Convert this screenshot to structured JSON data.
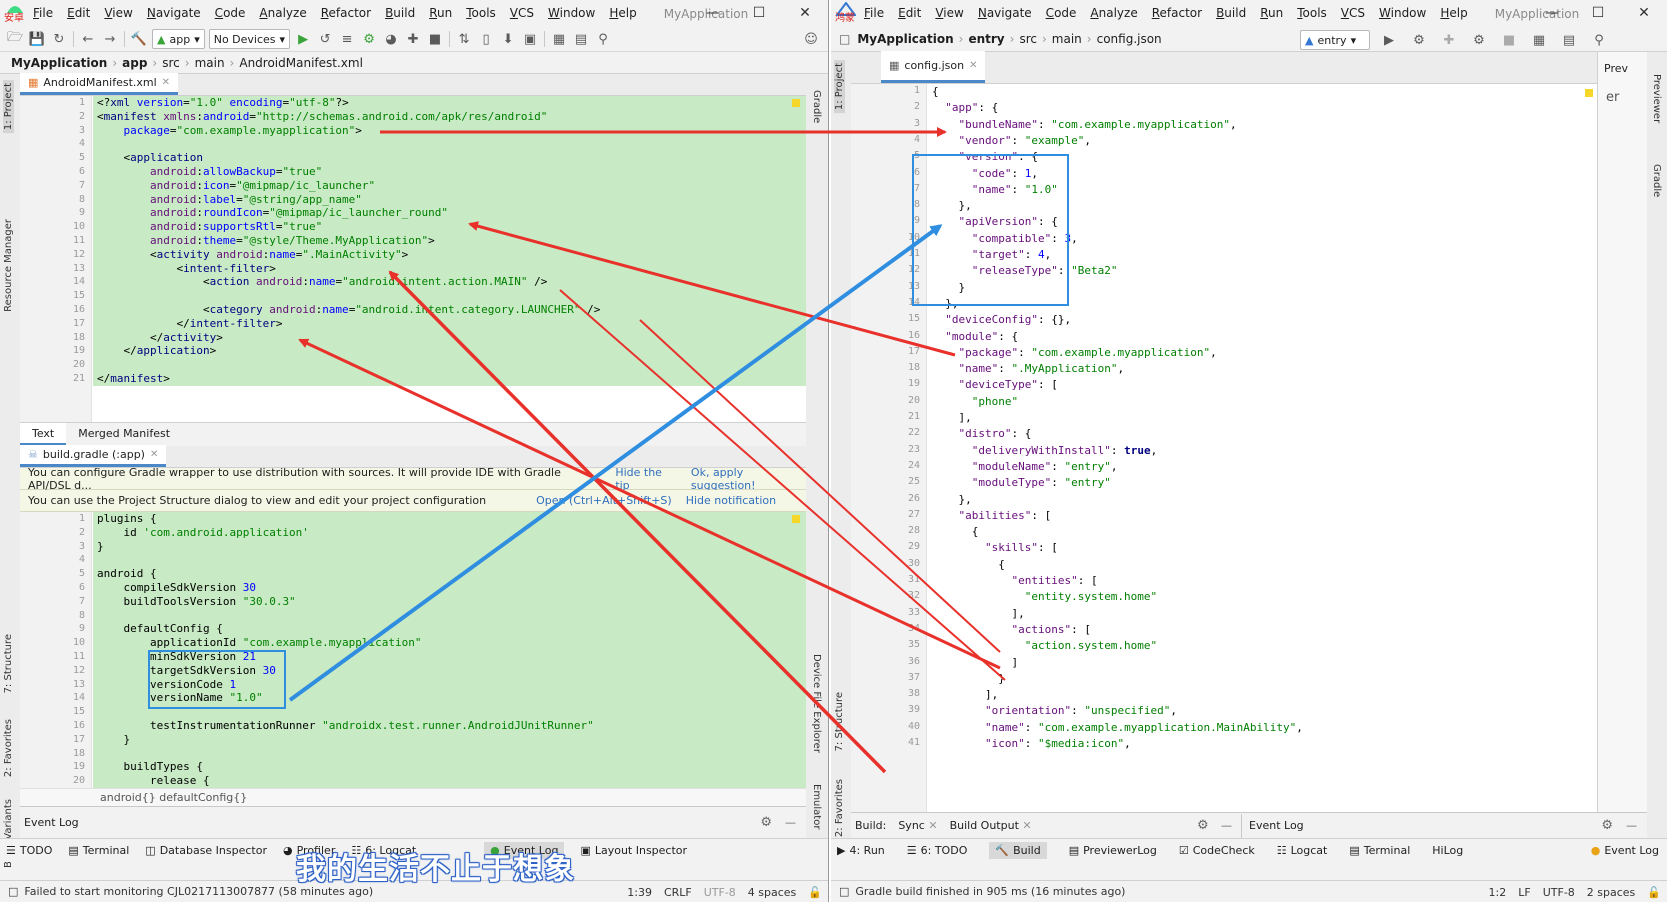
{
  "left": {
    "brand_tag": "安卓",
    "menu": [
      "File",
      "Edit",
      "View",
      "Navigate",
      "Code",
      "Analyze",
      "Refactor",
      "Build",
      "Run",
      "Tools",
      "VCS",
      "Window",
      "Help"
    ],
    "title": "MyApplication",
    "toolbar": {
      "module": "app",
      "device": "No Devices"
    },
    "breadcrumb": [
      "MyApplication",
      "app",
      "src",
      "main",
      "AndroidManifest.xml"
    ],
    "side_tabs": [
      "1: Project",
      "Resource Manager",
      "7: Structure",
      "2: Favorites",
      "Build Variants"
    ],
    "right_side_tabs": [
      "Gradle",
      "Device File Explorer",
      "Emulator"
    ],
    "manifest_tab": "AndroidManifest.xml",
    "manifest_lines": [
      "<?xml version=\"1.0\" encoding=\"utf-8\"?>",
      "<manifest xmlns:android=\"http://schemas.android.com/apk/res/android\"",
      "    package=\"com.example.myapplication\">",
      "",
      "    <application",
      "        android:allowBackup=\"true\"",
      "        android:icon=\"@mipmap/ic_launcher\"",
      "        android:label=\"@string/app_name\"",
      "        android:roundIcon=\"@mipmap/ic_launcher_round\"",
      "        android:supportsRtl=\"true\"",
      "        android:theme=\"@style/Theme.MyApplication\">",
      "        <activity android:name=\".MainActivity\">",
      "            <intent-filter>",
      "                <action android:name=\"android.intent.action.MAIN\" />",
      "",
      "                <category android:name=\"android.intent.category.LAUNCHER\" />",
      "            </intent-filter>",
      "        </activity>",
      "    </application>",
      "",
      "</manifest>"
    ],
    "manifest_subtabs": [
      "Text",
      "Merged Manifest"
    ],
    "gradle_tab": "build.gradle (:app)",
    "notice1": {
      "text": "You can configure Gradle wrapper to use distribution with sources. It will provide IDE with Gradle API/DSL d...",
      "link1": "Hide the tip",
      "link2": "Ok, apply suggestion!"
    },
    "notice2": {
      "text": "You can use the Project Structure dialog to view and edit your project configuration",
      "link1": "Open (Ctrl+Alt+Shift+S)",
      "link2": "Hide notification"
    },
    "gradle_lines": [
      "plugins {",
      "    id 'com.android.application'",
      "}",
      "",
      "android {",
      "    compileSdkVersion 30",
      "    buildToolsVersion \"30.0.3\"",
      "",
      "    defaultConfig {",
      "        applicationId \"com.example.myapplication\"",
      "        minSdkVersion 21",
      "        targetSdkVersion 30",
      "        versionCode 1",
      "        versionName \"1.0\"",
      "",
      "        testInstrumentationRunner \"androidx.test.runner.AndroidJUnitRunner\"",
      "    }",
      "",
      "    buildTypes {",
      "        release {"
    ],
    "gradle_breadcrumb": "android{}   defaultConfig{}",
    "event_log_title": "Event Log",
    "bottom_tabs": [
      "TODO",
      "Terminal",
      "Database Inspector",
      "Profiler",
      "6: Logcat",
      "Event Log",
      "Layout Inspector"
    ],
    "status": "Failed to start monitoring CJL0217113007877 (58 minutes ago)",
    "status_right": [
      "1:39",
      "CRLF",
      "UTF-8",
      "4 spaces"
    ]
  },
  "right": {
    "brand_tag": "鸿蒙",
    "menu": [
      "File",
      "Edit",
      "View",
      "Navigate",
      "Code",
      "Analyze",
      "Refactor",
      "Build",
      "Run",
      "Tools",
      "VCS",
      "Window",
      "Help"
    ],
    "title": "MyApplication",
    "toolbar": {
      "module": "entry"
    },
    "breadcrumb": [
      "MyApplication",
      "entry",
      "src",
      "main",
      "config.json"
    ],
    "side_tabs": [
      "1: Project",
      "7: Structure",
      "2: Favorites"
    ],
    "right_side_tabs": [
      "Previewer",
      "Gradle"
    ],
    "preview_label": "Prev",
    "preview_glyph": "er",
    "config_tab": "config.json",
    "config_lines": [
      "{",
      "  \"app\": {",
      "    \"bundleName\": \"com.example.myapplication\",",
      "    \"vendor\": \"example\",",
      "    \"version\": {",
      "      \"code\": 1,",
      "      \"name\": \"1.0\"",
      "    },",
      "    \"apiVersion\": {",
      "      \"compatible\": 3,",
      "      \"target\": 4,",
      "      \"releaseType\": \"Beta2\"",
      "    }",
      "  },",
      "  \"deviceConfig\": {},",
      "  \"module\": {",
      "    \"package\": \"com.example.myapplication\",",
      "    \"name\": \".MyApplication\",",
      "    \"deviceType\": [",
      "      \"phone\"",
      "    ],",
      "    \"distro\": {",
      "      \"deliveryWithInstall\": true,",
      "      \"moduleName\": \"entry\",",
      "      \"moduleType\": \"entry\"",
      "    },",
      "    \"abilities\": [",
      "      {",
      "        \"skills\": [",
      "          {",
      "            \"entities\": [",
      "              \"entity.system.home\"",
      "            ],",
      "            \"actions\": [",
      "              \"action.system.home\"",
      "            ]",
      "          }",
      "        ],",
      "        \"orientation\": \"unspecified\",",
      "        \"name\": \"com.example.myapplication.MainAbility\",",
      "        \"icon\": \"$media:icon\","
    ],
    "build_panel": {
      "label": "Build:",
      "tab1": "Sync",
      "tab2": "Build Output"
    },
    "event_log_title": "Event Log",
    "bottom_tabs": [
      "4: Run",
      "6: TODO",
      "Build",
      "PreviewerLog",
      "CodeCheck",
      "Logcat",
      "Terminal",
      "HiLog"
    ],
    "event_log_tab": "Event Log",
    "status": "Gradle build finished in 905 ms (16 minutes ago)",
    "status_right": [
      "1:2",
      "LF",
      "UTF-8",
      "2 spaces"
    ]
  },
  "watermark": "我的生活不止于想象",
  "colors": {
    "arrow_red": "#e8312b",
    "arrow_blue": "#2f8ee0",
    "code_highlight": "#c8eac4"
  }
}
